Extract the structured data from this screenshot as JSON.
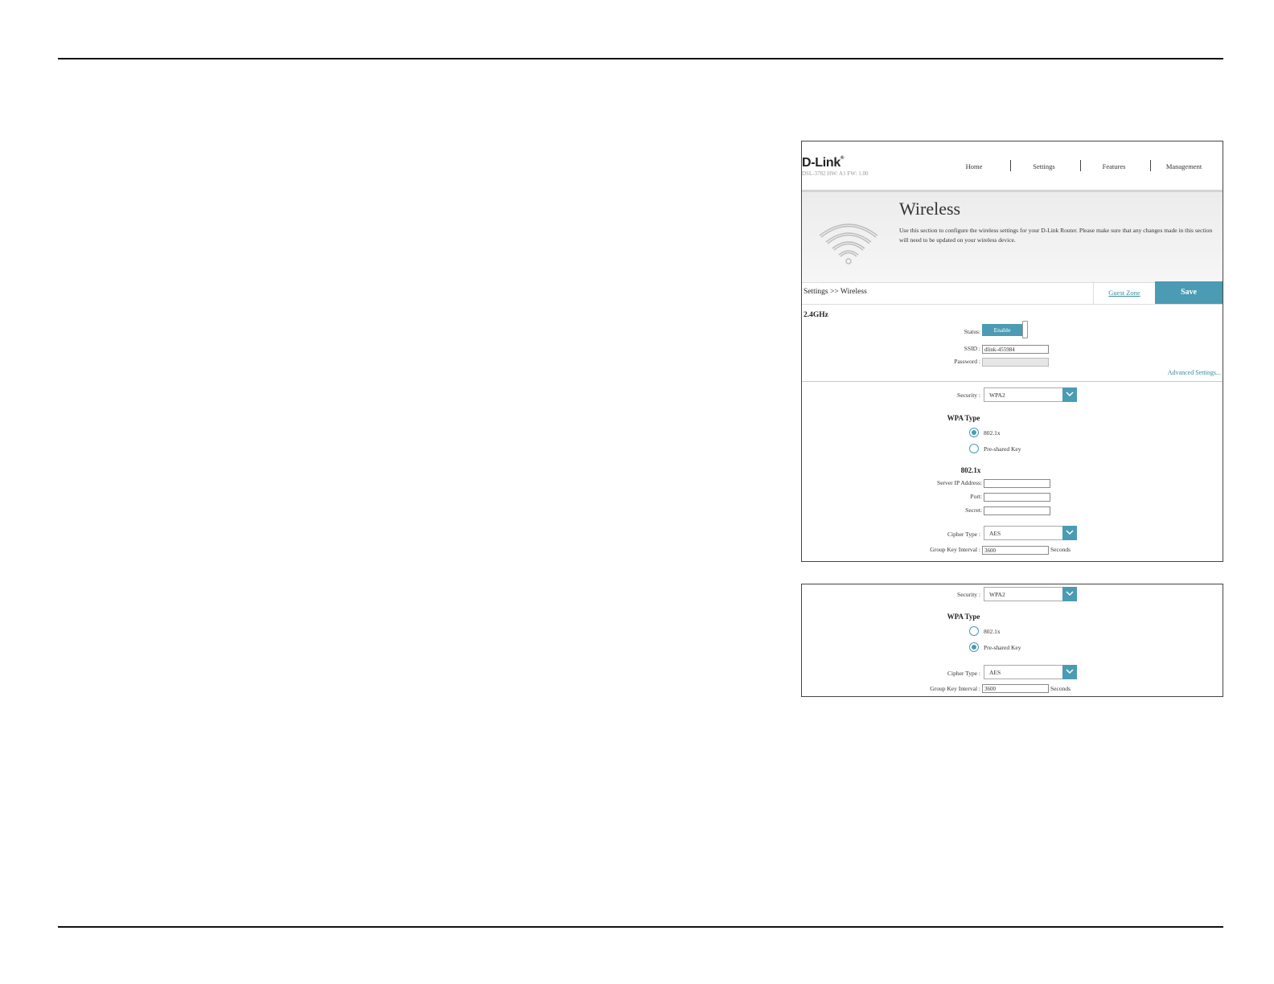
{
  "header": {
    "logo": "D-Link",
    "model_info": "DSL-3782   HW: A1   FW: 1.00",
    "nav": [
      "Home",
      "Settings",
      "Features",
      "Management"
    ]
  },
  "banner": {
    "title": "Wireless",
    "description": "Use this section to configure the wireless settings for your D-Link Router. Please make sure that any changes made in this section will need to be updated on your wireless device."
  },
  "crumbs": {
    "path": "Settings >> Wireless",
    "guest_zone": "Guest Zone",
    "save": "Save"
  },
  "band": {
    "name": "2.4GHz",
    "status_label": "Status:",
    "status_value": "Enable",
    "ssid_label": "SSID :",
    "ssid_value": "dlink-455984",
    "password_label": "Password :",
    "advanced": "Advanced Settings..."
  },
  "panel1": {
    "security_label": "Security :",
    "security_value": "WPA2",
    "wpa_type_title": "WPA Type",
    "radio_8021x": "802.1x",
    "radio_psk": "Pre-shared Key",
    "section_8021x": "802.1x",
    "server_ip_label": "Server IP Address:",
    "port_label": "Port:",
    "secret_label": "Secret:",
    "cipher_label": "Cipher Type :",
    "cipher_value": "AES",
    "gki_label": "Group Key Interval :",
    "gki_value": "3600",
    "gki_unit": "Seconds"
  },
  "panel2": {
    "security_label": "Security :",
    "security_value": "WPA2",
    "wpa_type_title": "WPA Type",
    "radio_8021x": "802.1x",
    "radio_psk": "Pre-shared Key",
    "cipher_label": "Cipher Type :",
    "cipher_value": "AES",
    "gki_label": "Group Key Interval :",
    "gki_value": "3600",
    "gki_unit": "Seconds"
  }
}
